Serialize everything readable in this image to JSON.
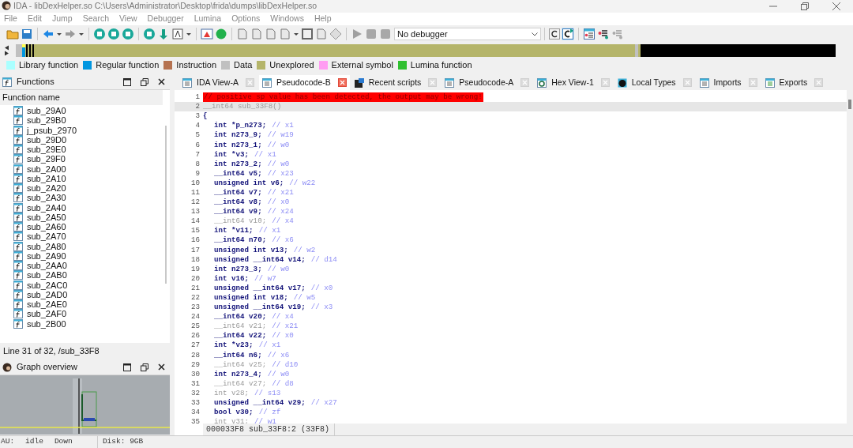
{
  "window": {
    "title": "IDA - libDexHelper.so C:\\Users\\Administrator\\Desktop\\frida\\dumps\\libDexHelper.so"
  },
  "menu": [
    "File",
    "Edit",
    "Jump",
    "Search",
    "View",
    "Debugger",
    "Lumina",
    "Options",
    "Windows",
    "Help"
  ],
  "toolbar": {
    "debugger_select": "No debugger"
  },
  "legend": [
    {
      "label": "Library function",
      "color": "#aaffff"
    },
    {
      "label": "Regular function",
      "color": "#0096e0"
    },
    {
      "label": "Instruction",
      "color": "#b57250"
    },
    {
      "label": "Data",
      "color": "#c0c0c0"
    },
    {
      "label": "Unexplored",
      "color": "#b5b56a"
    },
    {
      "label": "External symbol",
      "color": "#ff9cf2"
    },
    {
      "label": "Lumina function",
      "color": "#30c030"
    }
  ],
  "functions_panel": {
    "title": "Functions",
    "column": "Function name",
    "items": [
      "sub_29A0",
      "sub_29B0",
      "j_psub_2970",
      "sub_29D0",
      "sub_29E0",
      "sub_29F0",
      "sub_2A00",
      "sub_2A10",
      "sub_2A20",
      "sub_2A30",
      "sub_2A40",
      "sub_2A50",
      "sub_2A60",
      "sub_2A70",
      "sub_2A80",
      "sub_2A90",
      "sub_2AA0",
      "sub_2AB0",
      "sub_2AC0",
      "sub_2AD0",
      "sub_2AE0",
      "sub_2AF0",
      "sub_2B00"
    ],
    "status": "Line 31 of 32, /sub_33F8"
  },
  "graph_overview": {
    "title": "Graph overview"
  },
  "tabs": [
    {
      "label": "IDA View-A",
      "selected": false
    },
    {
      "label": "Pseudocode-B",
      "selected": true
    },
    {
      "label": "Recent scripts",
      "selected": false
    },
    {
      "label": "Pseudocode-A",
      "selected": false
    },
    {
      "label": "Hex View-1",
      "selected": false
    },
    {
      "label": "Local Types",
      "selected": false
    },
    {
      "label": "Imports",
      "selected": false
    },
    {
      "label": "Exports",
      "selected": false
    }
  ],
  "code": [
    {
      "number": "1",
      "kind": "warning",
      "text": "// positive sp value has been detected, the output may be wrong!",
      "current": false
    },
    {
      "number": "2",
      "kind": "code",
      "text": "__int64 sub_33F8()",
      "dimmed": true,
      "current": true
    },
    {
      "number": "3",
      "kind": "code",
      "text": "{",
      "dimmed": false,
      "current": false,
      "children": [
        {
          "number": "4",
          "text": "int *p_n273;",
          "comment": "// x1",
          "dimmed": false,
          "current": false
        },
        {
          "number": "5",
          "text": "int n273_9;",
          "comment": "// w19",
          "dimmed": false,
          "current": false
        },
        {
          "number": "6",
          "text": "int n273_1;",
          "comment": "// w0",
          "dimmed": false,
          "current": false
        },
        {
          "number": "7",
          "text": "int *v3;",
          "comment": "// x1",
          "dimmed": false,
          "current": false
        },
        {
          "number": "8",
          "text": "int n273_2;",
          "comment": "// w0",
          "dimmed": false,
          "current": false
        },
        {
          "number": "9",
          "text": "__int64 v5;",
          "comment": "// x23",
          "dimmed": false,
          "current": false
        },
        {
          "number": "10",
          "text": "unsigned int v6;",
          "comment": "// w22",
          "dimmed": false,
          "current": false
        },
        {
          "number": "11",
          "text": "__int64 v7;",
          "comment": "// x21",
          "dimmed": false,
          "current": false
        },
        {
          "number": "12",
          "text": "__int64 v8;",
          "comment": "// x0",
          "dimmed": false,
          "current": false
        },
        {
          "number": "13",
          "text": "__int64 v9;",
          "comment": "// x24",
          "dimmed": false,
          "current": false
        },
        {
          "number": "14",
          "text": "__int64 v10;",
          "comment": "// x4",
          "dimmed": true,
          "current": false
        },
        {
          "number": "15",
          "text": "int *v11;",
          "comment": "// x1",
          "dimmed": false,
          "current": false
        },
        {
          "number": "16",
          "text": "__int64 n70;",
          "comment": "// x6",
          "dimmed": false,
          "current": false
        },
        {
          "number": "17",
          "text": "unsigned int v13;",
          "comment": "// w2",
          "dimmed": false,
          "current": false
        },
        {
          "number": "18",
          "text": "unsigned __int64 v14;",
          "comment": "// d14",
          "dimmed": false,
          "current": false
        },
        {
          "number": "19",
          "text": "int n273_3;",
          "comment": "// w0",
          "dimmed": false,
          "current": false
        },
        {
          "number": "20",
          "text": "int v16;",
          "comment": "// w7",
          "dimmed": false,
          "current": false
        },
        {
          "number": "21",
          "text": "unsigned __int64 v17;",
          "comment": "// x0",
          "dimmed": false,
          "current": false
        },
        {
          "number": "22",
          "text": "unsigned int v18;",
          "comment": "// w5",
          "dimmed": false,
          "current": false
        },
        {
          "number": "23",
          "text": "unsigned __int64 v19;",
          "comment": "// x3",
          "dimmed": false,
          "current": false
        },
        {
          "number": "24",
          "text": "__int64 v20;",
          "comment": "// x4",
          "dimmed": false,
          "current": false
        },
        {
          "number": "25",
          "text": "__int64 v21;",
          "comment": "// x21",
          "dimmed": true,
          "current": false
        },
        {
          "number": "26",
          "text": "__int64 v22;",
          "comment": "// x0",
          "dimmed": false,
          "current": false
        },
        {
          "number": "27",
          "text": "int *v23;",
          "comment": "// x1",
          "dimmed": false,
          "current": false
        },
        {
          "number": "28",
          "text": "__int64 n6;",
          "comment": "// x6",
          "dimmed": false,
          "current": false
        },
        {
          "number": "29",
          "text": "__int64 v25;",
          "comment": "// d10",
          "dimmed": true,
          "current": false
        },
        {
          "number": "30",
          "text": "int n273_4;",
          "comment": "// w0",
          "dimmed": false,
          "current": false
        },
        {
          "number": "31",
          "text": "__int64 v27;",
          "comment": "// d8",
          "dimmed": true,
          "current": false
        },
        {
          "number": "32",
          "text": "int v28;",
          "comment": "// s13",
          "dimmed": true,
          "current": false
        },
        {
          "number": "33",
          "text": "unsigned __int64 v29;",
          "comment": "// x27",
          "dimmed": false,
          "current": false
        },
        {
          "number": "34",
          "text": "bool v30;",
          "comment": "// zf",
          "dimmed": false,
          "current": false
        },
        {
          "number": "35",
          "text": "int v31;",
          "comment": "// w1",
          "dimmed": true,
          "current": false
        }
      ]
    }
  ],
  "code_status": "000033F8 sub_33F8:2 (33F8)",
  "status_bar": [
    "AU:",
    "idle",
    "Down",
    "Disk: 9GB"
  ]
}
